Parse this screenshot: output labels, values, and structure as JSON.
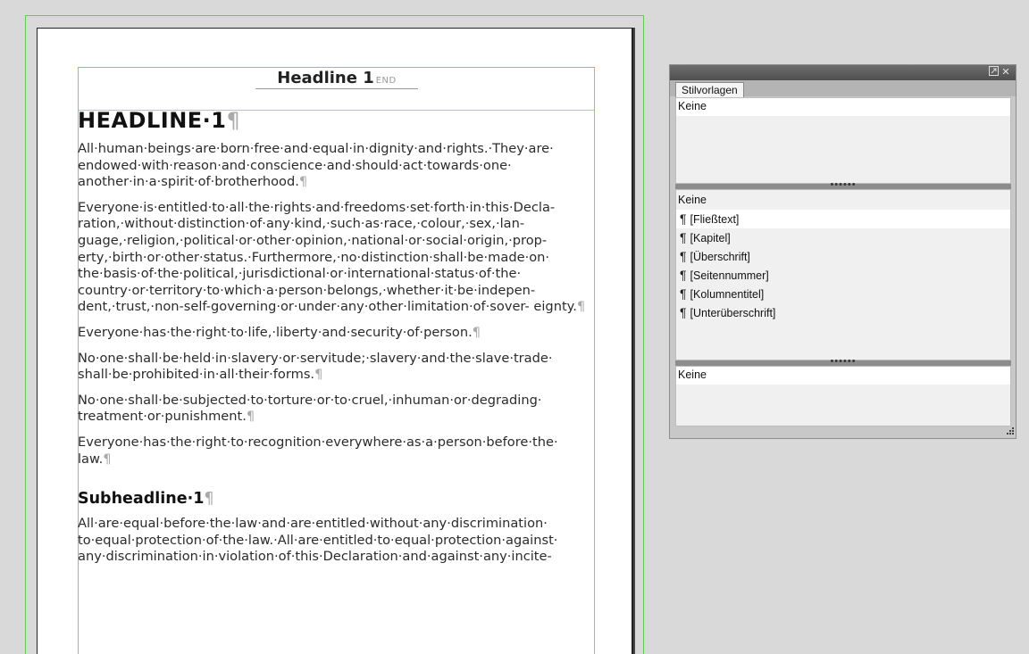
{
  "document": {
    "running_head": {
      "title": "Headline 1",
      "end_marker": "END"
    },
    "headline": "HEADLINE·1",
    "pilcrow": "¶",
    "paragraphs_1": [
      "All·human·beings·are·born·free·and·equal·in·dignity·and·rights.·They·are· endowed·with·reason·and·conscience·and·should·act·towards·one· another·in·a·spirit·of·brotherhood.",
      "Everyone·is·entitled·to·all·the·rights·and·freedoms·set·forth·in·this·Decla- ration,·without·distinction·of·any·kind,·such·as·race,·colour,·sex,·lan- guage,·religion,·political·or·other·opinion,·national·or·social·origin,·prop- erty,·birth·or·other·status.·Furthermore,·no·distinction·shall·be·made·on· the·basis·of·the·political,·jurisdictional·or·international·status·of·the· country·or·territory·to·which·a·person·belongs,·whether·it·be·indepen- dent,·trust,·non-self-governing·or·under·any·other·limitation·of·sover- eignty.",
      "Everyone·has·the·right·to·life,·liberty·and·security·of·person.",
      "No·one·shall·be·held·in·slavery·or·servitude;·slavery·and·the·slave·trade· shall·be·prohibited·in·all·their·forms.",
      "No·one·shall·be·subjected·to·torture·or·to·cruel,·inhuman·or·degrading· treatment·or·punishment.",
      "Everyone·has·the·right·to·recognition·everywhere·as·a·person·before·the· law."
    ],
    "subheadline": "Subheadline·1",
    "paragraphs_2": [
      "All·are·equal·before·the·law·and·are·entitled·without·any·discrimination· to·equal·protection·of·the·law.·All·are·entitled·to·equal·protection·against· any·discrimination·in·violation·of·this·Declaration·and·against·any·incite-"
    ]
  },
  "panel": {
    "tab_label": "Stilvorlagen",
    "section1_first": "Keine",
    "section2_first": "Keine",
    "styles": [
      "[Fließtext]",
      "[Kapitel]",
      "[Überschrift]",
      "[Seitennummer]",
      "[Kolumnentitel]",
      "[Unterüberschrift]"
    ],
    "section3_first": "Keine",
    "grip": "••••••",
    "icons": {
      "expand": "expand-icon",
      "close": "close-icon",
      "paragraph": "pilcrow-icon",
      "resize": "resize-grip-icon"
    }
  }
}
